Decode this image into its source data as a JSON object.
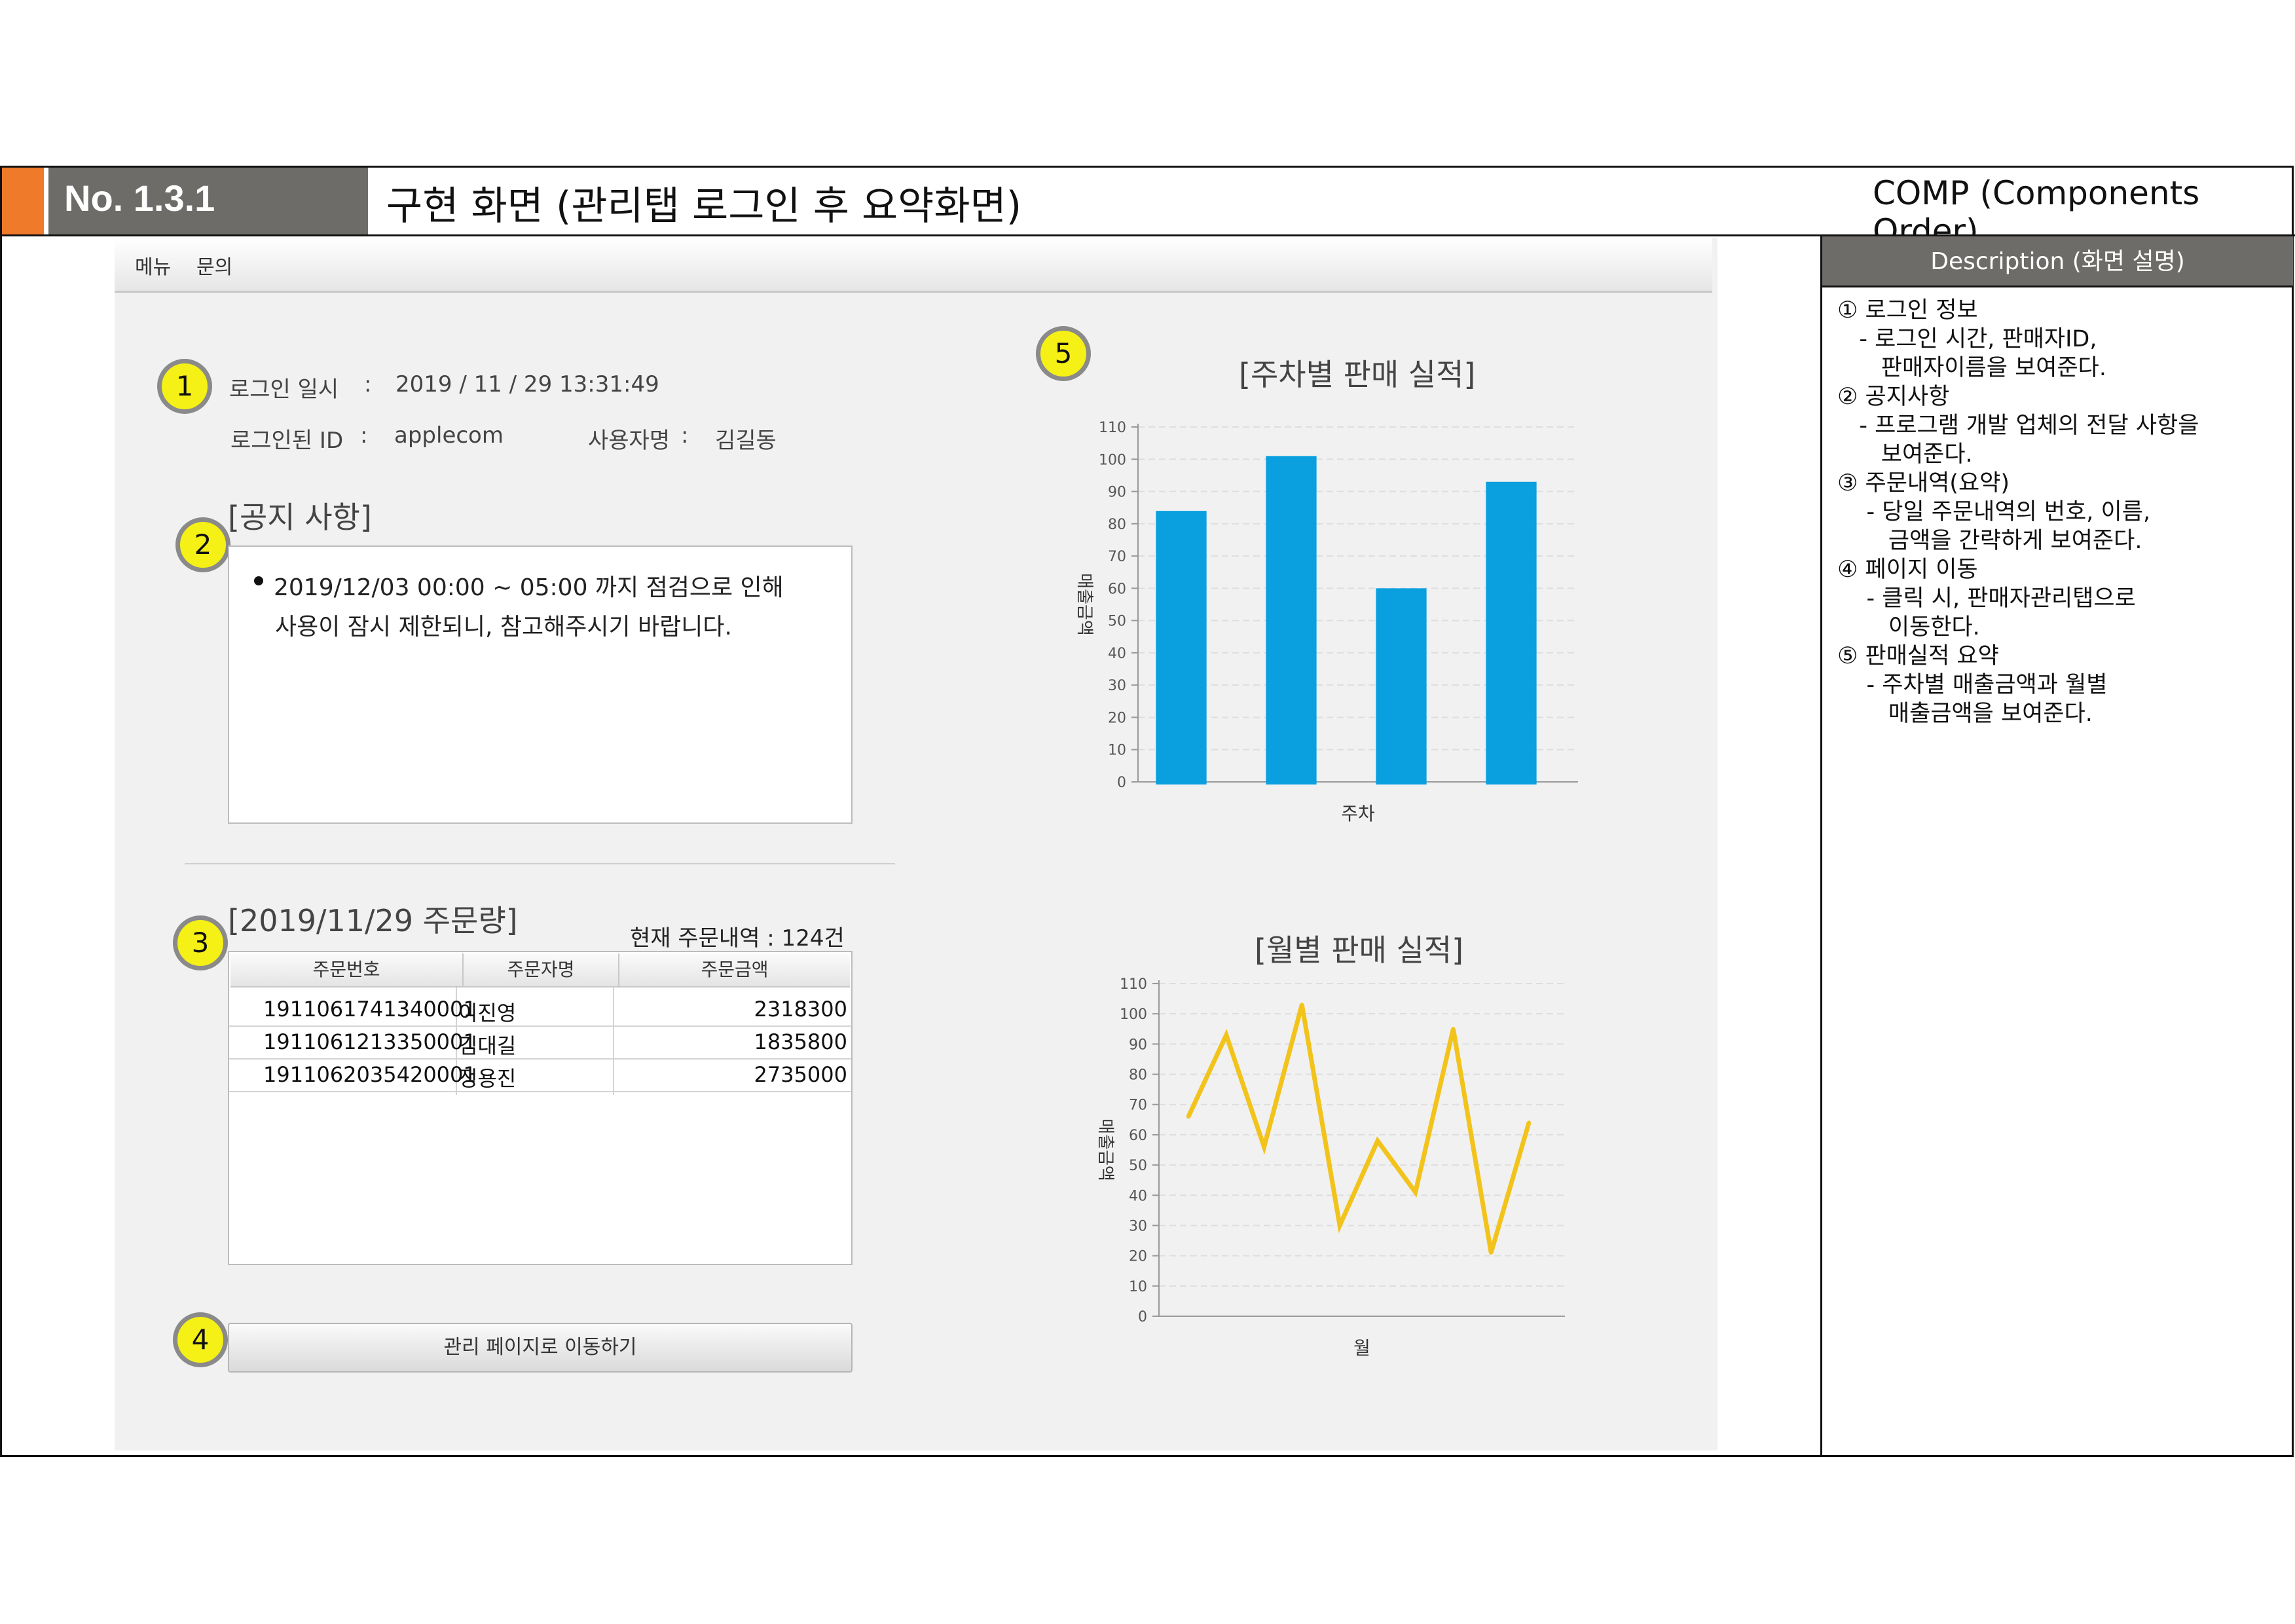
{
  "header": {
    "number": "No. 1.3.1",
    "title": "구현 화면 (관리탭 로그인 후 요약화면)",
    "comp": "COMP (Components Order)"
  },
  "description": {
    "heading": "Description (화면 설명)",
    "lines": [
      "① 로그인 정보",
      "   - 로그인 시간, 판매자ID,",
      "      판매자이름을 보여준다.",
      "② 공지사항",
      "   - 프로그램 개발 업체의 전달 사항을",
      "      보여준다.",
      "③ 주문내역(요약)",
      "    - 당일 주문내역의 번호, 이름,",
      "       금액을 간략하게 보여준다.",
      "④ 페이지 이동",
      "    - 클릭 시, 판매자관리탭으로",
      "       이동한다.",
      "⑤ 판매실적 요약",
      "    - 주차별 매출금액과 월별",
      "       매출금액을 보여준다."
    ]
  },
  "menu": {
    "item1": "메뉴",
    "item2": "문의"
  },
  "callouts": [
    "1",
    "2",
    "3",
    "4",
    "5"
  ],
  "login": {
    "time_label": "로그인 일시",
    "sep": ":",
    "time_value": "2019 / 11 / 29 13:31:49",
    "id_label": "로그인된 ID",
    "id_value": "applecom",
    "user_label": "사용자명",
    "user_value": "김길동"
  },
  "notice": {
    "title": "[공지 사항]",
    "line1": "2019/12/03 00:00 ~ 05:00 까지 점검으로 인해",
    "line2": "사용이  잠시 제한되니, 참고해주시기 바랍니다."
  },
  "orders": {
    "title": "[2019/11/29 주문량]",
    "summary": "현재 주문내역 : 124건",
    "columns": [
      "주문번호",
      "주문자명",
      "주문금액"
    ],
    "rows": [
      [
        "1911061741340001",
        "이진영",
        "2318300"
      ],
      [
        "1911061213350001",
        "김대길",
        "1835800"
      ],
      [
        "1911062035420001",
        "정용진",
        "2735000"
      ]
    ]
  },
  "move_button": "관리 페이지로 이동하기",
  "colors": {
    "bar": "#0aa0e0",
    "line": "#f2c31b",
    "callout": "#f5f015",
    "header_orange": "#ef7a2a"
  },
  "chart_data": [
    {
      "type": "bar",
      "title": "[주차별 판매 실적]",
      "xlabel": "주차",
      "ylabel": "매출금액",
      "ylim": [
        0,
        110
      ],
      "yticks": [
        0,
        10,
        20,
        30,
        40,
        50,
        60,
        70,
        80,
        90,
        100,
        110
      ],
      "values": [
        84,
        101,
        60,
        93
      ],
      "grid": true
    },
    {
      "type": "line",
      "title": "[월별 판매 실적]",
      "xlabel": "월",
      "ylabel": "매출금액",
      "ylim": [
        0,
        110
      ],
      "yticks": [
        0,
        10,
        20,
        30,
        40,
        50,
        60,
        70,
        80,
        90,
        100,
        110
      ],
      "values": [
        66,
        93,
        56,
        103,
        30,
        58,
        41,
        95,
        21,
        64
      ],
      "grid": true
    }
  ]
}
